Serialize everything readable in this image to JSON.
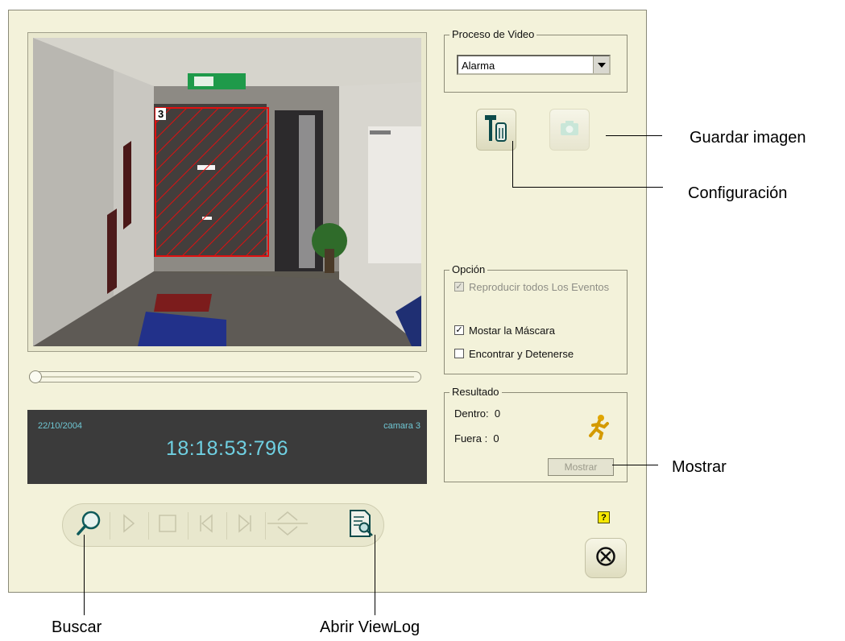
{
  "video_panel": {
    "zone_number": "3"
  },
  "display": {
    "date": "22/10/2004",
    "camera": "camara 3",
    "time": "18:18:53:796"
  },
  "proceso": {
    "title": "Proceso de Video",
    "selected": "Alarma"
  },
  "opcion": {
    "title": "Opción",
    "items": [
      {
        "label": "Reproducir todos Los Eventos",
        "checked": true,
        "disabled": true
      },
      {
        "label": "Mostar la Máscara",
        "checked": true,
        "disabled": false
      },
      {
        "label": "Encontrar y Detenerse",
        "checked": false,
        "disabled": false
      }
    ]
  },
  "resultado": {
    "title": "Resultado",
    "dentro_label": "Dentro:",
    "dentro_value": "0",
    "fuera_label": "Fuera :",
    "fuera_value": "0",
    "mostrar_label": "Mostrar"
  },
  "help": {
    "glyph": "?"
  },
  "callouts": {
    "guardar": "Guardar imagen",
    "config": "Configuración",
    "mostrar": "Mostrar",
    "buscar": "Buscar",
    "viewlog": "Abrir ViewLog"
  },
  "icons": [
    "search-icon",
    "play-icon",
    "stop-icon",
    "previous-icon",
    "next-icon",
    "speed-icon",
    "viewlog-icon",
    "settings-icon",
    "camera-icon",
    "running-person-icon",
    "help-icon",
    "close-icon"
  ]
}
